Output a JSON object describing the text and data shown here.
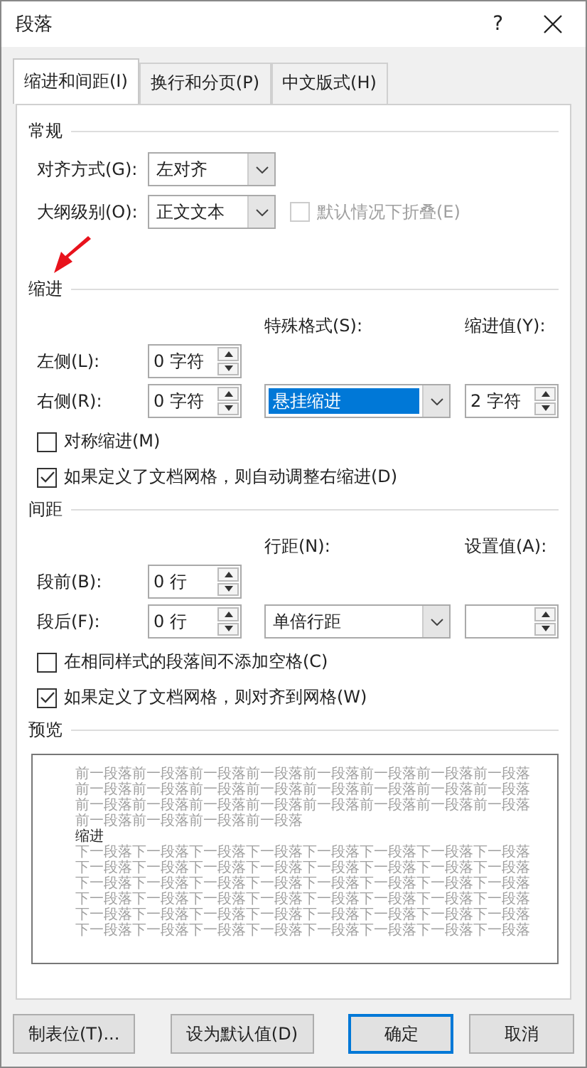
{
  "window": {
    "title": "段落",
    "help": "?"
  },
  "tabs": [
    {
      "label": "缩进和间距(I)",
      "selected": true
    },
    {
      "label": "换行和分页(P)",
      "selected": false
    },
    {
      "label": "中文版式(H)",
      "selected": false
    }
  ],
  "general": {
    "heading": "常规",
    "alignment": {
      "label": "对齐方式(G):",
      "value": "左对齐"
    },
    "outline": {
      "label": "大纲级别(O):",
      "value": "正文文本"
    },
    "collapse": {
      "label": "默认情况下折叠(E)",
      "checked": false,
      "disabled": true
    }
  },
  "indent": {
    "heading": "缩进",
    "left": {
      "label": "左侧(L):",
      "value": "0 字符"
    },
    "right": {
      "label": "右侧(R):",
      "value": "0 字符"
    },
    "special": {
      "label": "特殊格式(S):",
      "value": "悬挂缩进",
      "selected": true
    },
    "by": {
      "label": "缩进值(Y):",
      "value": "2 字符"
    },
    "checks": [
      {
        "label": "对称缩进(M)",
        "checked": false
      },
      {
        "label": "如果定义了文档网格，则自动调整右缩进(D)",
        "checked": true
      }
    ]
  },
  "spacing": {
    "heading": "间距",
    "before": {
      "label": "段前(B):",
      "value": "0 行"
    },
    "after": {
      "label": "段后(F):",
      "value": "0 行"
    },
    "line_spacing": {
      "label": "行距(N):",
      "value": "单倍行距"
    },
    "at": {
      "label": "设置值(A):"
    },
    "checks": [
      {
        "label": "在相同样式的段落间不添加空格(C)",
        "checked": false
      },
      {
        "label": "如果定义了文档网格，则对齐到网格(W)",
        "checked": true
      }
    ]
  },
  "preview": {
    "heading": "预览",
    "previous": "前一段落前一段落前一段落前一段落前一段落前一段落前一段落前一段落前一段落前一段落前一段落前一段落前一段落前一段落前一段落前一段落前一段落前一段落前一段落前一段落前一段落前一段落前一段落前一段落前一段落前一段落前一段落前一段落",
    "current": "缩进",
    "next": "下一段落下一段落下一段落下一段落下一段落下一段落下一段落下一段落下一段落下一段落下一段落下一段落下一段落下一段落下一段落下一段落下一段落下一段落下一段落下一段落下一段落下一段落下一段落下一段落下一段落下一段落下一段落下一段落下一段落下一段落下一段落下一段落下一段落下一段落下一段落下一段落下一段落下一段落下一段落下一段落下一段落下一段落下一段落下一段落下一段落下一段落下一段落下一段落"
  },
  "buttons": [
    {
      "label": "制表位(T)...",
      "kind": "normal"
    },
    {
      "label": "设为默认值(D)",
      "kind": "normal"
    },
    {
      "label": "确定",
      "kind": "default"
    },
    {
      "label": "取消",
      "kind": "normal"
    }
  ]
}
